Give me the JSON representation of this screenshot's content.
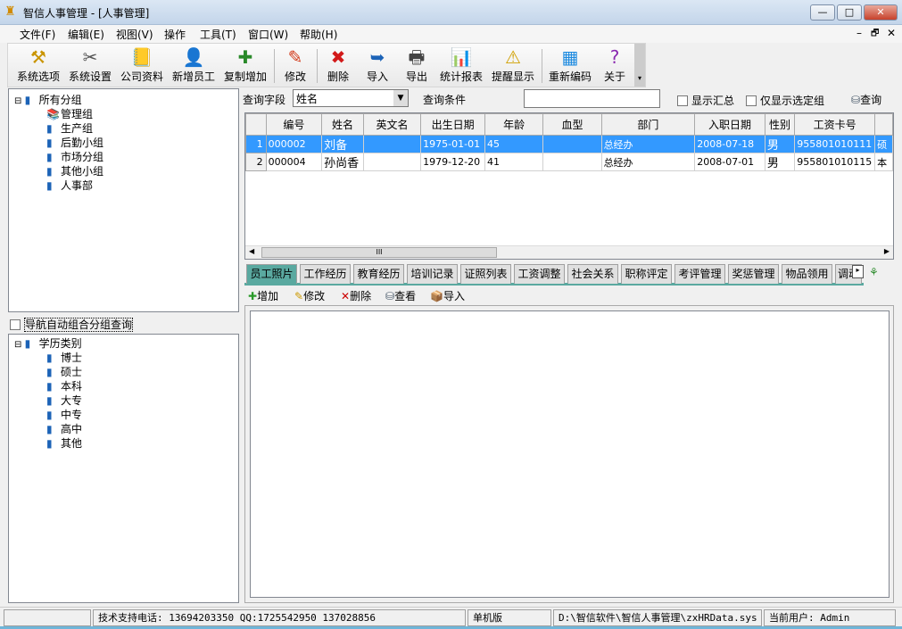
{
  "window": {
    "title": "智信人事管理 - [人事管理]",
    "minimize": "—",
    "maximize": "□",
    "close": "✕"
  },
  "menu": [
    "文件(F)",
    "编辑(E)",
    "视图(V)",
    "操作",
    "工具(T)",
    "窗口(W)",
    "帮助(H)"
  ],
  "mdi_controls": [
    "–",
    "🗗",
    "✕"
  ],
  "toolbar": [
    {
      "label": "系统选项",
      "icon": "hammer-icon"
    },
    {
      "label": "系统设置",
      "icon": "tools-icon"
    },
    {
      "label": "公司资料",
      "icon": "book-icon"
    },
    {
      "label": "新增员工",
      "icon": "add-user-icon"
    },
    {
      "label": "复制增加",
      "icon": "copy-add-icon"
    },
    {
      "label": "修改",
      "icon": "pencil-icon"
    },
    {
      "label": "删除",
      "icon": "delete-icon"
    },
    {
      "label": "导入",
      "icon": "import-icon"
    },
    {
      "label": "导出",
      "icon": "export-icon"
    },
    {
      "label": "统计报表",
      "icon": "chart-icon"
    },
    {
      "label": "提醒显示",
      "icon": "warning-icon"
    },
    {
      "label": "重新编码",
      "icon": "calendar-icon"
    },
    {
      "label": "关于",
      "icon": "help-icon"
    }
  ],
  "tree_groups": {
    "root": "所有分组",
    "items": [
      "管理组",
      "生产组",
      "后勤小组",
      "市场分组",
      "其他小组",
      "人事部"
    ]
  },
  "nav_checkbox": "导航自动组合分组查询",
  "tree_edu": {
    "root": "学历类别",
    "items": [
      "博士",
      "硕士",
      "本科",
      "大专",
      "中专",
      "高中",
      "其他"
    ]
  },
  "query": {
    "field_label": "查询字段",
    "field_value": "姓名",
    "cond_label": "查询条件",
    "cond_value": "",
    "show_summary": "显示汇总",
    "only_selected": "仅显示选定组",
    "search": "查询"
  },
  "grid": {
    "columns": [
      "编号",
      "姓名",
      "英文名",
      "出生日期",
      "年龄",
      "血型",
      "部门",
      "入职日期",
      "性别",
      "工资卡号",
      ""
    ],
    "rows": [
      [
        "1",
        "000002",
        "刘备",
        "",
        "1975-01-01",
        "45",
        "",
        "总经办",
        "2008-07-18",
        "男",
        "955801010111",
        "硕"
      ],
      [
        "2",
        "000004",
        "孙尚香",
        "",
        "1979-12-20",
        "41",
        "",
        "总经办",
        "2008-07-01",
        "男",
        "955801010115",
        "本"
      ]
    ],
    "scroll_grip": "III"
  },
  "tabs": [
    "员工照片",
    "工作经历",
    "教育经历",
    "培训记录",
    "证照列表",
    "工资调整",
    "社会关系",
    "职称评定",
    "考评管理",
    "奖惩管理",
    "物品领用",
    "调动"
  ],
  "subtoolbar": [
    "增加",
    "修改",
    "删除",
    "查看",
    "导入"
  ],
  "status": [
    "",
    "技术支持电话: 13694203350 QQ:1725542950 137028856",
    "单机版",
    "D:\\智信软件\\智信人事管理\\zxHRData.sys",
    "当前用户: Admin"
  ]
}
